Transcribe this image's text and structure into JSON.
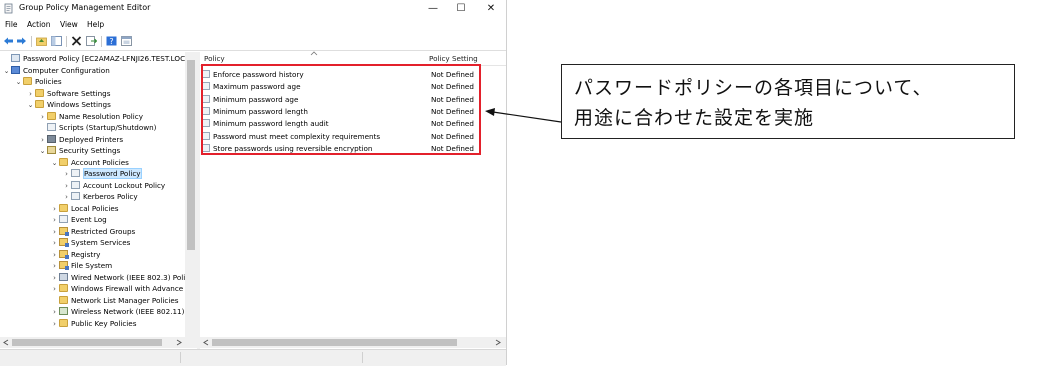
{
  "window": {
    "title": "Group Policy Management Editor",
    "controls": {
      "minimize": "—",
      "maximize": "☐",
      "close": "✕"
    }
  },
  "menu": [
    "File",
    "Action",
    "View",
    "Help"
  ],
  "toolbar_icons": [
    "back-arrow-icon",
    "forward-arrow-icon",
    "up-folder-icon",
    "show-hide-tree-icon",
    "delete-icon",
    "export-list-icon",
    "help-icon",
    "properties-icon"
  ],
  "tree": [
    {
      "label": "Password Policy [EC2AMAZ-LFNJI26.TEST.LOCAL",
      "indent": 0,
      "expander": "",
      "icon": "policy-icon"
    },
    {
      "label": "Computer Configuration",
      "indent": 0,
      "expander": "v",
      "icon": "computer-icon"
    },
    {
      "label": "Policies",
      "indent": 1,
      "expander": "v",
      "icon": "folder-icon"
    },
    {
      "label": "Software Settings",
      "indent": 2,
      "expander": ">",
      "icon": "folder-icon"
    },
    {
      "label": "Windows Settings",
      "indent": 2,
      "expander": "v",
      "icon": "folder-icon"
    },
    {
      "label": "Name Resolution Policy",
      "indent": 3,
      "expander": ">",
      "icon": "folder-icon"
    },
    {
      "label": "Scripts (Startup/Shutdown)",
      "indent": 3,
      "expander": "",
      "icon": "document-icon"
    },
    {
      "label": "Deployed Printers",
      "indent": 3,
      "expander": ">",
      "icon": "printer-icon"
    },
    {
      "label": "Security Settings",
      "indent": 3,
      "expander": "v",
      "icon": "shield-icon"
    },
    {
      "label": "Account Policies",
      "indent": 4,
      "expander": "v",
      "icon": "folder-icon"
    },
    {
      "label": "Password Policy",
      "indent": 5,
      "expander": ">",
      "icon": "document-icon",
      "selected": true
    },
    {
      "label": "Account Lockout Policy",
      "indent": 5,
      "expander": ">",
      "icon": "document-icon"
    },
    {
      "label": "Kerberos Policy",
      "indent": 5,
      "expander": ">",
      "icon": "document-icon"
    },
    {
      "label": "Local Policies",
      "indent": 4,
      "expander": ">",
      "icon": "folder-icon"
    },
    {
      "label": "Event Log",
      "indent": 4,
      "expander": ">",
      "icon": "document-icon"
    },
    {
      "label": "Restricted Groups",
      "indent": 4,
      "expander": ">",
      "icon": "lock-folder-icon"
    },
    {
      "label": "System Services",
      "indent": 4,
      "expander": ">",
      "icon": "lock-folder-icon"
    },
    {
      "label": "Registry",
      "indent": 4,
      "expander": ">",
      "icon": "lock-folder-icon"
    },
    {
      "label": "File System",
      "indent": 4,
      "expander": ">",
      "icon": "lock-folder-icon"
    },
    {
      "label": "Wired Network (IEEE 802.3) Polic",
      "indent": 4,
      "expander": ">",
      "icon": "wired-network-icon"
    },
    {
      "label": "Windows Firewall with Advance",
      "indent": 4,
      "expander": ">",
      "icon": "folder-icon"
    },
    {
      "label": "Network List Manager Policies",
      "indent": 4,
      "expander": "",
      "icon": "folder-icon"
    },
    {
      "label": "Wireless Network (IEEE 802.11) F",
      "indent": 4,
      "expander": ">",
      "icon": "wireless-network-icon"
    },
    {
      "label": "Public Key Policies",
      "indent": 4,
      "expander": ">",
      "icon": "folder-icon"
    }
  ],
  "list": {
    "columns": {
      "policy": "Policy",
      "setting": "Policy Setting"
    },
    "rows": [
      {
        "policy": "Enforce password history",
        "setting": "Not Defined"
      },
      {
        "policy": "Maximum password age",
        "setting": "Not Defined"
      },
      {
        "policy": "Minimum password age",
        "setting": "Not Defined"
      },
      {
        "policy": "Minimum password length",
        "setting": "Not Defined"
      },
      {
        "policy": "Minimum password length audit",
        "setting": "Not Defined"
      },
      {
        "policy": "Password must meet complexity requirements",
        "setting": "Not Defined"
      },
      {
        "policy": "Store passwords using reversible encryption",
        "setting": "Not Defined"
      }
    ]
  },
  "annotation": {
    "line1": "パスワードポリシーの各項目について、",
    "line2": "用途に合わせた設定を実施",
    "highlight_color": "#e3202b"
  }
}
